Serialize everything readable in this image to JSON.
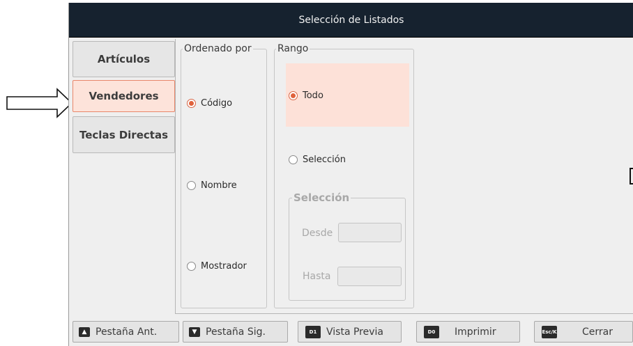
{
  "window": {
    "title": "Selección de Listados"
  },
  "tabs": [
    {
      "label": "Artículos",
      "active": false
    },
    {
      "label": "Vendedores",
      "active": true
    },
    {
      "label": "Teclas Directas",
      "active": false
    }
  ],
  "ordenado_por": {
    "legend": "Ordenado por",
    "options": [
      {
        "label": "Código",
        "selected": true
      },
      {
        "label": "Nombre",
        "selected": false
      },
      {
        "label": "Mostrador",
        "selected": false
      }
    ]
  },
  "rango": {
    "legend": "Rango",
    "options": [
      {
        "label": "Todo",
        "selected": true
      },
      {
        "label": "Selección",
        "selected": false
      }
    ],
    "seleccion": {
      "legend": "Selección",
      "desde_label": "Desde",
      "desde_value": "",
      "hasta_label": "Hasta",
      "hasta_value": ""
    }
  },
  "buttons": {
    "prev_tab": {
      "label": "Pestaña Ant.",
      "icon": "printer-up-icon"
    },
    "next_tab": {
      "label": "Pestaña Sig.",
      "icon": "printer-down-icon"
    },
    "preview": {
      "label": "Vista Previa",
      "key": "D1"
    },
    "print": {
      "label": "Imprimir",
      "key": "D0"
    },
    "close": {
      "label": "Cerrar",
      "key": "Esc/K"
    }
  },
  "colors": {
    "accent": "#e0623c",
    "selected_bg": "#fde1d8",
    "titlebar": "#16222f"
  }
}
